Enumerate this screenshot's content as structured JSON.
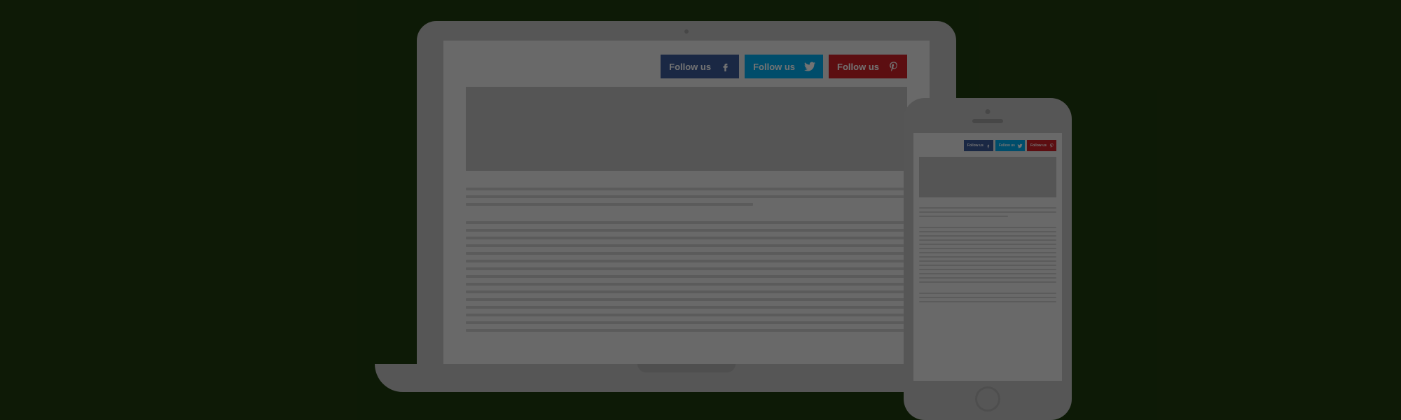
{
  "social": {
    "facebook": {
      "label": "Follow us",
      "icon": "facebook-icon"
    },
    "twitter": {
      "label": "Follow us",
      "icon": "twitter-icon"
    },
    "pinterest": {
      "label": "Follow us",
      "icon": "pinterest-icon"
    }
  },
  "colors": {
    "facebook": "#3b5998",
    "twitter": "#00acee",
    "pinterest": "#cc2127",
    "background": "#1e3a0e"
  }
}
